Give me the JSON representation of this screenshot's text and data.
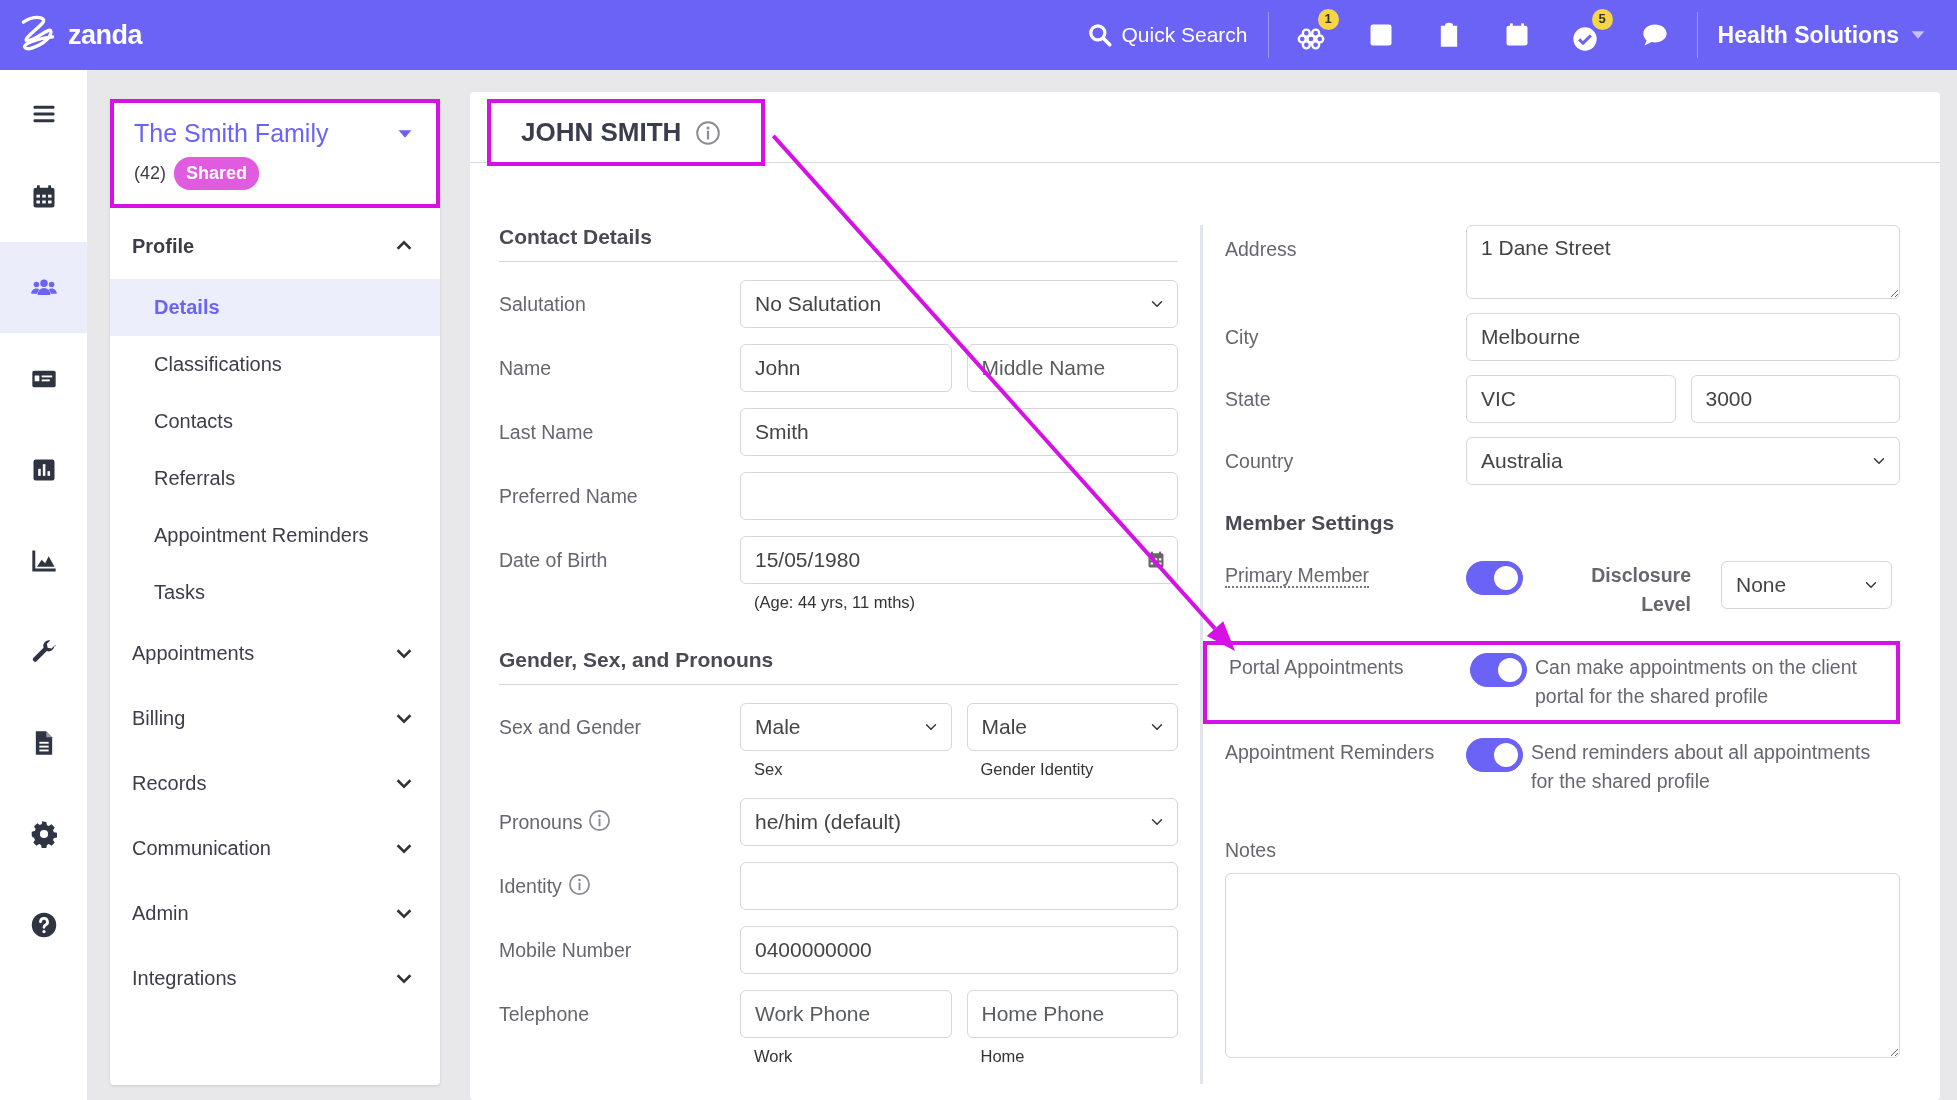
{
  "topbar": {
    "logo": "zanda",
    "search": "Quick Search",
    "icons": [
      {
        "kind": "modules",
        "badge": "1"
      },
      {
        "kind": "chart"
      },
      {
        "kind": "clipboard"
      },
      {
        "kind": "calendar"
      },
      {
        "kind": "check",
        "badge": "5"
      },
      {
        "kind": "chat"
      }
    ],
    "account": "Health Solutions"
  },
  "rail": [
    {
      "kind": "menu",
      "selected": false
    },
    {
      "kind": "calendar",
      "selected": false
    },
    {
      "kind": "people",
      "selected": true
    },
    {
      "kind": "money",
      "selected": false
    },
    {
      "kind": "chart",
      "selected": false
    },
    {
      "kind": "area",
      "selected": false
    },
    {
      "kind": "wrench",
      "selected": false
    },
    {
      "kind": "document",
      "selected": false
    },
    {
      "kind": "gear",
      "selected": false
    },
    {
      "kind": "help",
      "selected": false
    }
  ],
  "family": {
    "name": "The Smith Family",
    "count": "(42)",
    "badge": "Shared",
    "highlighted": true
  },
  "nav": [
    {
      "label": "Profile",
      "expanded": true,
      "children": [
        {
          "label": "Details",
          "selected": true
        },
        {
          "label": "Classifications",
          "selected": false
        },
        {
          "label": "Contacts",
          "selected": false
        },
        {
          "label": "Referrals",
          "selected": false
        },
        {
          "label": "Appointment Reminders",
          "selected": false
        },
        {
          "label": "Tasks",
          "selected": false
        }
      ]
    },
    {
      "label": "Appointments",
      "expanded": false
    },
    {
      "label": "Billing",
      "expanded": false
    },
    {
      "label": "Records",
      "expanded": false
    },
    {
      "label": "Communication",
      "expanded": false
    },
    {
      "label": "Admin",
      "expanded": false
    },
    {
      "label": "Integrations",
      "expanded": false
    }
  ],
  "title": {
    "text": "JOHN SMITH",
    "highlighted": true
  },
  "sections": [
    {
      "heading": "Contact Details",
      "rows": [
        {
          "label": "Salutation",
          "controls": [
            {
              "kind": "select",
              "value": "No Salutation"
            }
          ]
        },
        {
          "label": "Name",
          "controls": [
            {
              "kind": "input",
              "value": "John"
            },
            {
              "kind": "input",
              "placeholder": "Middle Name"
            }
          ]
        },
        {
          "label": "Last Name",
          "controls": [
            {
              "kind": "input",
              "value": "Smith"
            }
          ]
        },
        {
          "label": "Preferred Name",
          "controls": [
            {
              "kind": "input"
            }
          ]
        },
        {
          "label": "Date of Birth",
          "controls": [
            {
              "kind": "date",
              "value": "15/05/1980",
              "help": "(Age: 44 yrs, 11 mths)"
            }
          ]
        }
      ]
    },
    {
      "heading": "Gender, Sex, and Pronouns",
      "rows": [
        {
          "label": "Sex and Gender",
          "controls": [
            {
              "kind": "select",
              "value": "Male",
              "help": "Sex"
            },
            {
              "kind": "select",
              "value": "Male",
              "help": "Gender Identity"
            }
          ]
        },
        {
          "label": "Pronouns",
          "info": true,
          "controls": [
            {
              "kind": "select",
              "value": "he/him (default)"
            }
          ]
        },
        {
          "label": "Identity",
          "info": true,
          "controls": [
            {
              "kind": "input"
            }
          ]
        },
        {
          "label": "Mobile Number",
          "controls": [
            {
              "kind": "input",
              "value": "0400000000"
            }
          ]
        },
        {
          "label": "Telephone",
          "controls": [
            {
              "kind": "input",
              "placeholder": "Work Phone",
              "help": "Work"
            },
            {
              "kind": "input",
              "placeholder": "Home Phone",
              "help": "Home"
            }
          ]
        }
      ]
    }
  ],
  "address": [
    {
      "label": "Address",
      "controls": [
        {
          "kind": "textarea",
          "value": "1 Dane Street"
        }
      ]
    },
    {
      "label": "City",
      "controls": [
        {
          "kind": "input",
          "value": "Melbourne"
        }
      ]
    },
    {
      "label": "State",
      "controls": [
        {
          "kind": "input",
          "value": "VIC"
        },
        {
          "kind": "input",
          "value": "3000"
        }
      ]
    },
    {
      "label": "Country",
      "controls": [
        {
          "kind": "select",
          "value": "Australia"
        }
      ]
    }
  ],
  "member": {
    "heading": "Member Settings",
    "rows": [
      {
        "kind": "toggle_select",
        "label": "Primary Member",
        "highlighted": false,
        "on": true,
        "side_label": "Disclosure Level",
        "value": "None"
      },
      {
        "kind": "toggle",
        "label": "Portal Appointments",
        "on": true,
        "description": "Can make appointments on the client portal for the shared profile",
        "highlighted": true
      },
      {
        "kind": "toggle",
        "label": "Appointment Reminders",
        "on": true,
        "description": "Send reminders about all appointments for the shared profile",
        "highlighted": false
      }
    ]
  },
  "notes": {
    "label": "Notes"
  }
}
